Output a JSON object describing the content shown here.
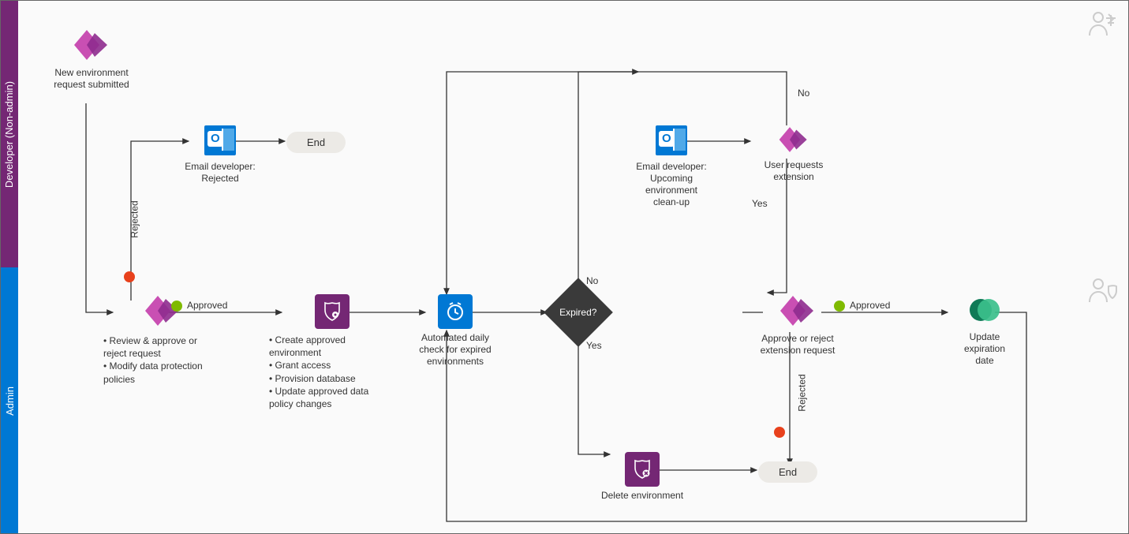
{
  "lanes": {
    "developer": "Developer (Non-admin)",
    "admin": "Admin"
  },
  "nodes": {
    "new_request": {
      "line1": "New environment",
      "line2": "request submitted"
    },
    "email_rejected": {
      "line1": "Email developer:",
      "line2": "Rejected"
    },
    "end1": "End",
    "review": {
      "b1": "Review & approve or reject request",
      "b2": "Modify data protection policies"
    },
    "create_env": {
      "b1": "Create approved environment",
      "b2": "Grant access",
      "b3": "Provision database",
      "b4": "Update approved data policy changes"
    },
    "daily_check": {
      "line1": "Automated daily",
      "line2": "check for expired",
      "line3": "environments"
    },
    "expired": "Expired?",
    "email_cleanup": {
      "line1": "Email developer:",
      "line2": "Upcoming",
      "line3": "environment",
      "line4": "clean-up"
    },
    "user_ext": {
      "line1": "User requests",
      "line2": "extension"
    },
    "approve_ext": {
      "line1": "Approve or reject",
      "line2": "extension request"
    },
    "update_exp": {
      "line1": "Update",
      "line2": "expiration",
      "line3": "date"
    },
    "delete_env": "Delete environment",
    "end2": "End"
  },
  "edges": {
    "approved": "Approved",
    "rejected": "Rejected",
    "yes": "Yes",
    "no": "No"
  }
}
